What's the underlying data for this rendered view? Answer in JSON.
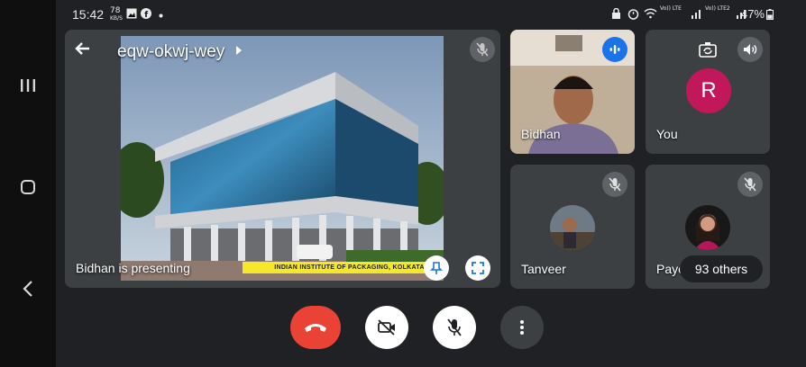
{
  "status_bar": {
    "time": "15:42",
    "speed_value": "78",
    "speed_unit": "KB/S",
    "signal_label_1": "Vo)) LTE",
    "signal_label_2": "Vo)) LTE2",
    "battery": "47%",
    "icons": [
      "gallery-icon",
      "facebook-icon",
      "dot-icon",
      "lock-icon",
      "alarm-icon",
      "wifi-icon",
      "signal-icon",
      "battery-icon"
    ]
  },
  "system_nav": {
    "icons": [
      "recent-apps-icon",
      "home-icon",
      "back-icon"
    ]
  },
  "meeting": {
    "code": "eqw-okwj-wey",
    "presenting_text": "Bidhan is presenting",
    "slide_caption": "INDIAN INSTITUTE OF PACKAGING, KOLKATA"
  },
  "participants": [
    {
      "id": "bidhan",
      "name": "Bidhan",
      "state": "speaking"
    },
    {
      "id": "you",
      "name": "You",
      "avatar_letter": "R",
      "avatar_color": "#c2185b"
    },
    {
      "id": "tanveer",
      "name": "Tanveer",
      "state": "muted"
    },
    {
      "id": "payel",
      "name": "Payel",
      "state": "muted"
    }
  ],
  "others_count_label": "93 others",
  "controls": {
    "end_call": "end-call-button",
    "camera": "camera-off-button",
    "mic": "mic-off-button",
    "more": "more-options-button"
  },
  "colors": {
    "end_call": "#ea4335",
    "speaking_badge": "#1a73e8",
    "avatar_you": "#c2185b",
    "tile_background": "#3c4043",
    "app_background": "#202124"
  }
}
